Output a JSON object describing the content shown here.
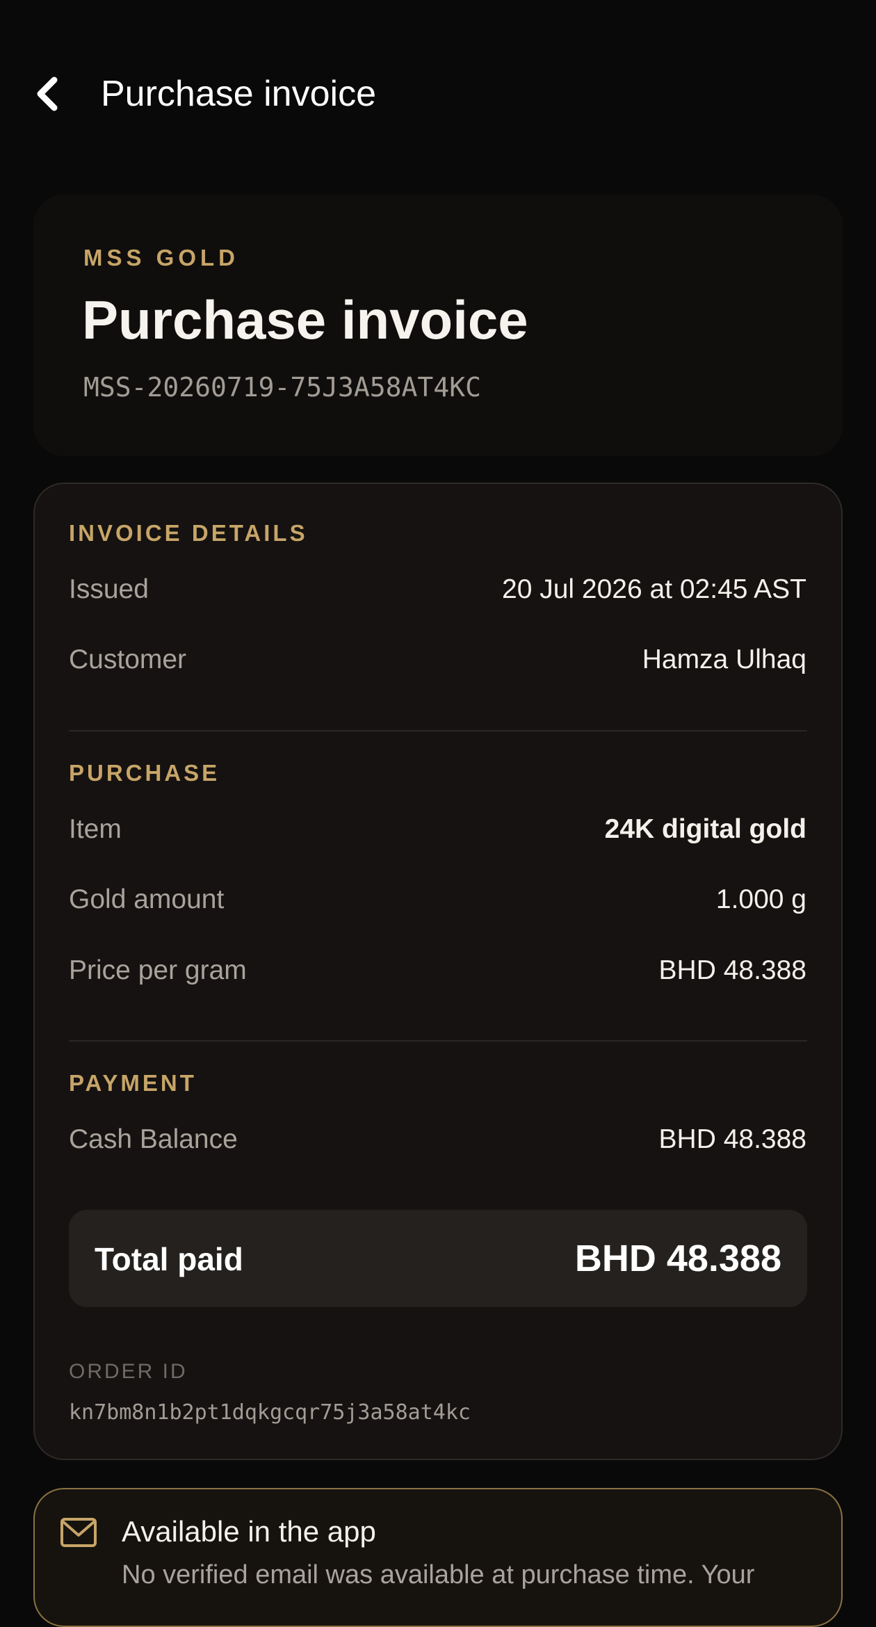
{
  "header": {
    "title": "Purchase invoice"
  },
  "hero": {
    "brand": "MSS GOLD",
    "title": "Purchase invoice",
    "reference": "MSS-20260719-75J3A58AT4KC"
  },
  "invoice_details": {
    "section_label": "INVOICE DETAILS",
    "issued_label": "Issued",
    "issued_value": "20 Jul 2026 at 02:45 AST",
    "customer_label": "Customer",
    "customer_value": "Hamza Ulhaq"
  },
  "purchase": {
    "section_label": "PURCHASE",
    "item_label": "Item",
    "item_value": "24K digital gold",
    "gold_amount_label": "Gold amount",
    "gold_amount_value": "1.000 g",
    "price_label": "Price per gram",
    "price_value": "BHD 48.388"
  },
  "payment": {
    "section_label": "PAYMENT",
    "method_label": "Cash Balance",
    "method_value": "BHD 48.388"
  },
  "total": {
    "label": "Total paid",
    "value": "BHD 48.388"
  },
  "order": {
    "label": "ORDER ID",
    "value": "kn7bm8n1b2pt1dqkgcqr75j3a58at4kc"
  },
  "notice": {
    "icon": "mail-icon",
    "title": "Available in the app",
    "body": "No verified email was available at purchase time. Your"
  },
  "colors": {
    "accent_gold": "#c7a568",
    "background": "#0a0909",
    "card": "#151211"
  }
}
